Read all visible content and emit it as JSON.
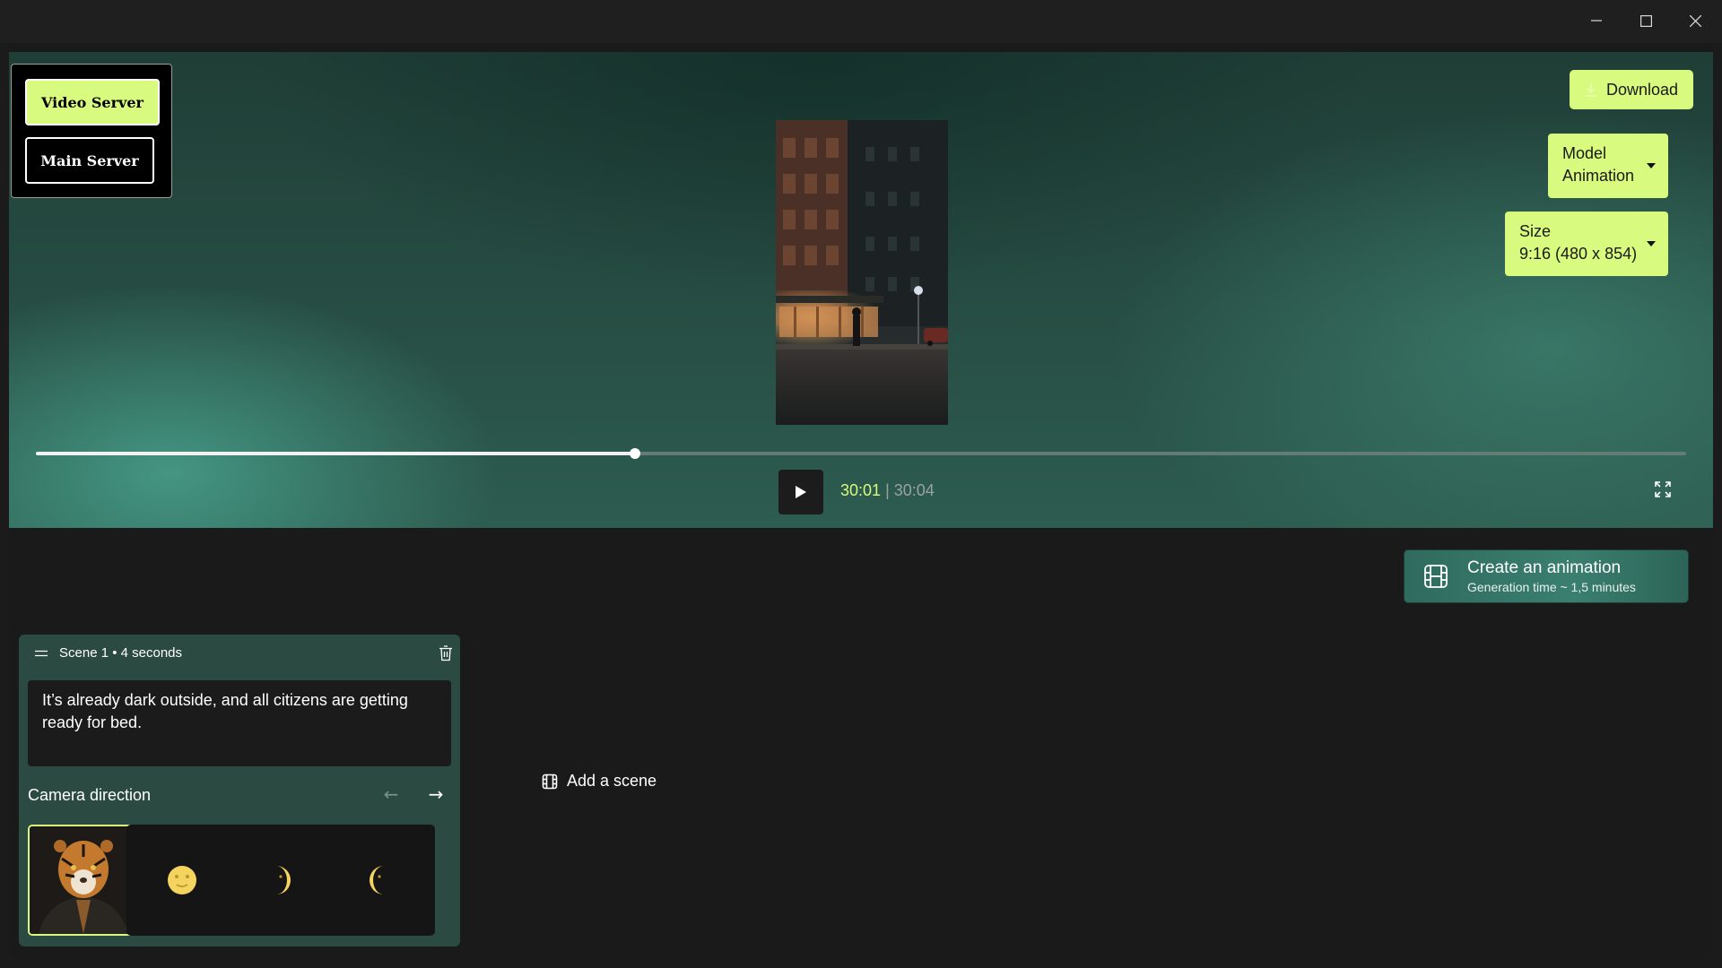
{
  "servers": {
    "active_label": "Video Server",
    "inactive_label": "Main Server"
  },
  "download_label": "Download",
  "model": {
    "label": "Model",
    "value": "Animation"
  },
  "size": {
    "label": "Size",
    "value": "9:16 (480 x 854)"
  },
  "player": {
    "current_time": "30:01",
    "separator": "|",
    "total_time": "30:04",
    "progress": 0.363
  },
  "create": {
    "title": "Create an animation",
    "subtitle": "Generation time ~ 1,5 minutes"
  },
  "scene": {
    "title": "Scene 1 • 4 seconds",
    "description": "It’s already dark outside, and all citizens are getting ready for bed.",
    "camera_label": "Camera direction",
    "thumbnails": [
      "tiger-portrait",
      "full-moon-face",
      "first-quarter-moon-face",
      "last-quarter-moon-face"
    ]
  },
  "add_scene_label": "Add a scene",
  "colors": {
    "accent": "#d8fa7e",
    "panel": "#2b4a42",
    "background": "#1b1b1b"
  }
}
